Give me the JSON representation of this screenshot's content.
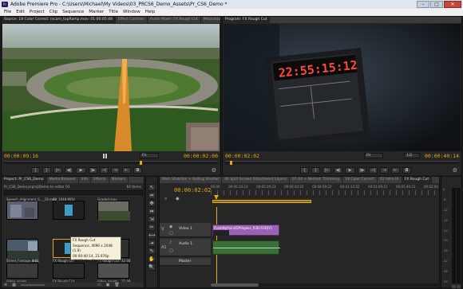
{
  "window": {
    "title": "Adobe Premiere Pro - C:\\Users\\Michael\\My Videos\\03_PRCS6_Demo_Assets\\Pr_CS6_Demo *",
    "app_badge": "Pr",
    "minimize": "–",
    "maximize": "□",
    "close": "✕"
  },
  "menu": [
    "File",
    "Edit",
    "Project",
    "Clip",
    "Sequence",
    "Marker",
    "Title",
    "Window",
    "Help"
  ],
  "source_panel": {
    "tabs": [
      "Source: 18 Color Correct: incam_topRamp.mov: 01:00:05:48",
      "Effect Controls",
      "Audio Mixer: FX Rough Cut",
      "Metadata"
    ],
    "timecode_in": "00:00:09:16",
    "zoom": "Fit",
    "timecode_dur": "00:00:02:00",
    "controls": [
      "{",
      "}",
      "|←",
      "◀|",
      "▶",
      "|▶",
      "→|",
      "⇥",
      "⇤",
      "◘"
    ]
  },
  "program_panel": {
    "tab": "Program: FX Rough Cut",
    "timecode_in": "00:00:02:02",
    "zoom": "Fit",
    "ratio": "1/2",
    "timecode_dur": "00:00:40:14",
    "slate_digits": "22:55:15:12",
    "controls": [
      "{",
      "}",
      "|←",
      "◀|",
      "▶",
      "|▶",
      "→|",
      "⇥",
      "⇤",
      "◘"
    ]
  },
  "project_panel": {
    "tabs": [
      "Project: Pr_CS6_Demo",
      "Media Browser",
      "Info",
      "Effects",
      "Markers"
    ],
    "path": "Pr_CS6_Demo.prproj\\Demo to editor 03",
    "count": "64 Items",
    "items": [
      {
        "name": "Speech_Alignment_0..._19.mov",
        "dur": "",
        "color": "#5a6070"
      },
      {
        "name": "09_1048.MOV",
        "dur": "",
        "color": "#2a2a2a"
      },
      {
        "name": "Graded.mov",
        "dur": "",
        "color": "#6a6a60"
      },
      {
        "name": "Street_Footage.mov",
        "dur": "0:01",
        "color": "#4a5a6a"
      },
      {
        "name": "FX Rough Cut",
        "dur": "",
        "color": "#2b2b2b"
      },
      {
        "name": "FX Rough Cut",
        "dur": "32:08",
        "color": "#303030"
      },
      {
        "name": "Video assets",
        "dur": "",
        "color": "#3a3a3a"
      },
      {
        "name": "FX Rough Cut",
        "dur": "",
        "color": "#2b2b2b"
      },
      {
        "name": "Video assets",
        "dur": "11:08",
        "color": "#505050"
      }
    ],
    "tooltip": {
      "line1": "FX Rough Cut",
      "line2": "Sequence, 4096 x 2048 (1.0)",
      "line3": "00:00:40:14, 23.976p",
      "line4": "48000 Hz - Stereo"
    }
  },
  "tools": [
    "↖",
    "⇔",
    "✥",
    "⇹",
    "⇲",
    "✂",
    "⟷",
    "⇥",
    "✎",
    "✋",
    "🔍"
  ],
  "timeline_panel": {
    "tabs": [
      "Main Stabilize + Rolling Shutter",
      "06 Split Screen Adjustment Layers",
      "07 Ad + Nested: Trimming",
      "18 Color Correct",
      "02 Intro UI",
      "FX Rough Cut"
    ],
    "timecode": "00:00:02:02",
    "ruler": [
      "00:00",
      "00:00:14:23",
      "00:00:29:23",
      "00:00:44:22",
      "00:00:59:22",
      "00:01:14:22",
      "00:01:29:21",
      "00:01:44:21",
      "00:02:00"
    ],
    "tracks": [
      {
        "id": "V",
        "label": "Video 1"
      },
      {
        "id": "A1",
        "label": "Audio 1"
      },
      {
        "id": "",
        "label": "Master"
      }
    ],
    "clip_label": "FlashMyPairs[DP]Agees_R3D.R3D[V]"
  },
  "audio_meter": {
    "scale": [
      "0",
      "-6",
      "-12",
      "-18",
      "-24",
      "-30",
      "-36",
      "-42",
      "-48",
      "-54"
    ]
  },
  "colors": {
    "accent": "#e8a90d",
    "clip": "#9a62b4",
    "titlebar": "#dfe6ef"
  }
}
